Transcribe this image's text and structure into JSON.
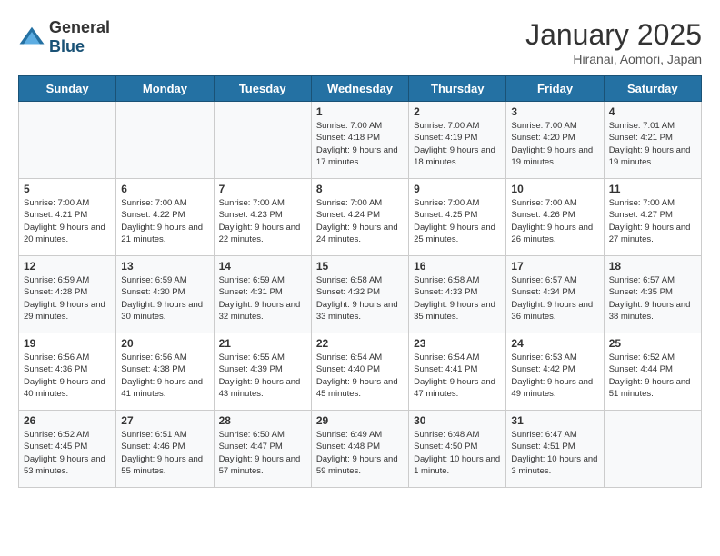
{
  "header": {
    "logo_general": "General",
    "logo_blue": "Blue",
    "month": "January 2025",
    "location": "Hiranai, Aomori, Japan"
  },
  "days_of_week": [
    "Sunday",
    "Monday",
    "Tuesday",
    "Wednesday",
    "Thursday",
    "Friday",
    "Saturday"
  ],
  "weeks": [
    [
      {
        "day": "",
        "info": ""
      },
      {
        "day": "",
        "info": ""
      },
      {
        "day": "",
        "info": ""
      },
      {
        "day": "1",
        "info": "Sunrise: 7:00 AM\nSunset: 4:18 PM\nDaylight: 9 hours and 17 minutes."
      },
      {
        "day": "2",
        "info": "Sunrise: 7:00 AM\nSunset: 4:19 PM\nDaylight: 9 hours and 18 minutes."
      },
      {
        "day": "3",
        "info": "Sunrise: 7:00 AM\nSunset: 4:20 PM\nDaylight: 9 hours and 19 minutes."
      },
      {
        "day": "4",
        "info": "Sunrise: 7:01 AM\nSunset: 4:21 PM\nDaylight: 9 hours and 19 minutes."
      }
    ],
    [
      {
        "day": "5",
        "info": "Sunrise: 7:00 AM\nSunset: 4:21 PM\nDaylight: 9 hours and 20 minutes."
      },
      {
        "day": "6",
        "info": "Sunrise: 7:00 AM\nSunset: 4:22 PM\nDaylight: 9 hours and 21 minutes."
      },
      {
        "day": "7",
        "info": "Sunrise: 7:00 AM\nSunset: 4:23 PM\nDaylight: 9 hours and 22 minutes."
      },
      {
        "day": "8",
        "info": "Sunrise: 7:00 AM\nSunset: 4:24 PM\nDaylight: 9 hours and 24 minutes."
      },
      {
        "day": "9",
        "info": "Sunrise: 7:00 AM\nSunset: 4:25 PM\nDaylight: 9 hours and 25 minutes."
      },
      {
        "day": "10",
        "info": "Sunrise: 7:00 AM\nSunset: 4:26 PM\nDaylight: 9 hours and 26 minutes."
      },
      {
        "day": "11",
        "info": "Sunrise: 7:00 AM\nSunset: 4:27 PM\nDaylight: 9 hours and 27 minutes."
      }
    ],
    [
      {
        "day": "12",
        "info": "Sunrise: 6:59 AM\nSunset: 4:28 PM\nDaylight: 9 hours and 29 minutes."
      },
      {
        "day": "13",
        "info": "Sunrise: 6:59 AM\nSunset: 4:30 PM\nDaylight: 9 hours and 30 minutes."
      },
      {
        "day": "14",
        "info": "Sunrise: 6:59 AM\nSunset: 4:31 PM\nDaylight: 9 hours and 32 minutes."
      },
      {
        "day": "15",
        "info": "Sunrise: 6:58 AM\nSunset: 4:32 PM\nDaylight: 9 hours and 33 minutes."
      },
      {
        "day": "16",
        "info": "Sunrise: 6:58 AM\nSunset: 4:33 PM\nDaylight: 9 hours and 35 minutes."
      },
      {
        "day": "17",
        "info": "Sunrise: 6:57 AM\nSunset: 4:34 PM\nDaylight: 9 hours and 36 minutes."
      },
      {
        "day": "18",
        "info": "Sunrise: 6:57 AM\nSunset: 4:35 PM\nDaylight: 9 hours and 38 minutes."
      }
    ],
    [
      {
        "day": "19",
        "info": "Sunrise: 6:56 AM\nSunset: 4:36 PM\nDaylight: 9 hours and 40 minutes."
      },
      {
        "day": "20",
        "info": "Sunrise: 6:56 AM\nSunset: 4:38 PM\nDaylight: 9 hours and 41 minutes."
      },
      {
        "day": "21",
        "info": "Sunrise: 6:55 AM\nSunset: 4:39 PM\nDaylight: 9 hours and 43 minutes."
      },
      {
        "day": "22",
        "info": "Sunrise: 6:54 AM\nSunset: 4:40 PM\nDaylight: 9 hours and 45 minutes."
      },
      {
        "day": "23",
        "info": "Sunrise: 6:54 AM\nSunset: 4:41 PM\nDaylight: 9 hours and 47 minutes."
      },
      {
        "day": "24",
        "info": "Sunrise: 6:53 AM\nSunset: 4:42 PM\nDaylight: 9 hours and 49 minutes."
      },
      {
        "day": "25",
        "info": "Sunrise: 6:52 AM\nSunset: 4:44 PM\nDaylight: 9 hours and 51 minutes."
      }
    ],
    [
      {
        "day": "26",
        "info": "Sunrise: 6:52 AM\nSunset: 4:45 PM\nDaylight: 9 hours and 53 minutes."
      },
      {
        "day": "27",
        "info": "Sunrise: 6:51 AM\nSunset: 4:46 PM\nDaylight: 9 hours and 55 minutes."
      },
      {
        "day": "28",
        "info": "Sunrise: 6:50 AM\nSunset: 4:47 PM\nDaylight: 9 hours and 57 minutes."
      },
      {
        "day": "29",
        "info": "Sunrise: 6:49 AM\nSunset: 4:48 PM\nDaylight: 9 hours and 59 minutes."
      },
      {
        "day": "30",
        "info": "Sunrise: 6:48 AM\nSunset: 4:50 PM\nDaylight: 10 hours and 1 minute."
      },
      {
        "day": "31",
        "info": "Sunrise: 6:47 AM\nSunset: 4:51 PM\nDaylight: 10 hours and 3 minutes."
      },
      {
        "day": "",
        "info": ""
      }
    ]
  ]
}
